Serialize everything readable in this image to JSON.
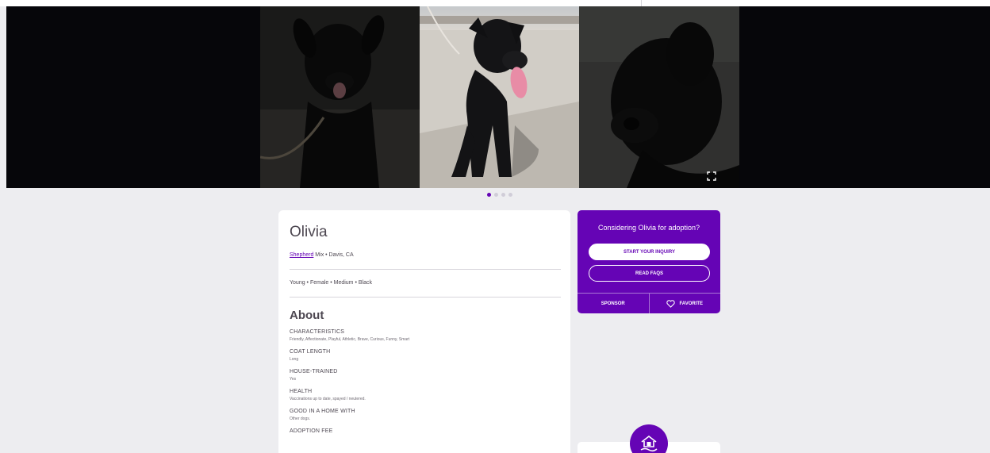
{
  "pet": {
    "name": "Olivia",
    "breed_link": "Shepherd",
    "breed_rest": " Mix  •  Davis, CA",
    "attributes": "Young  •  Female  •  Medium  •  Black"
  },
  "about": {
    "title": "About",
    "details": [
      {
        "label": "CHARACTERISTICS",
        "value": "Friendly, Affectionate, Playful, Athletic, Brave, Curious, Funny, Smart"
      },
      {
        "label": "COAT LENGTH",
        "value": "Long"
      },
      {
        "label": "HOUSE-TRAINED",
        "value": "Yes"
      },
      {
        "label": "HEALTH",
        "value": "Vaccinations up to date, spayed / neutered."
      },
      {
        "label": "GOOD IN A HOME WITH",
        "value": "Other dogs."
      },
      {
        "label": "ADOPTION FEE",
        "value": ""
      }
    ]
  },
  "adopt_panel": {
    "heading": "Considering Olivia for adoption?",
    "inquiry_label": "START YOUR INQUIRY",
    "faqs_label": "READ FAQS",
    "sponsor_label": "SPONSOR",
    "favorite_label": "FAVORITE"
  },
  "carousel": {
    "slides": [
      "dog-photo-1",
      "dog-photo-2",
      "dog-photo-3"
    ],
    "active_dot": 1,
    "dot_count": 4
  },
  "icons": {
    "expand": "expand-icon",
    "heart": "heart-icon",
    "home": "home-hand-icon"
  },
  "colors": {
    "brand_purple": "#6504b5",
    "page_bg": "#ededf0",
    "carousel_bg": "#06060a"
  }
}
